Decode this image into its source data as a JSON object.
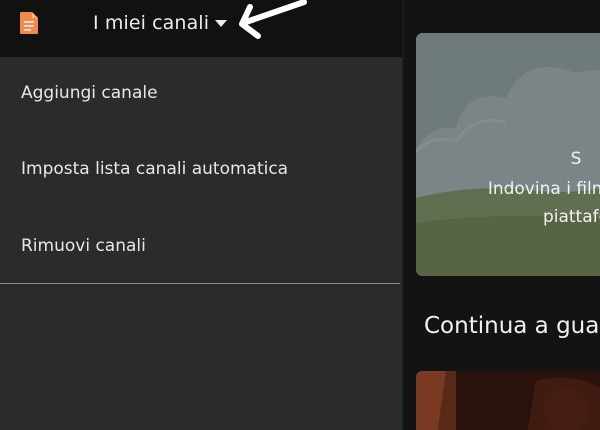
{
  "header": {
    "doc_icon": "document-icon",
    "channels_dropdown_label": "I miei canali",
    "caret_icon": "caret-down-icon",
    "annotation_icon": "arrow-left-icon"
  },
  "menu": {
    "items": [
      {
        "label": "Aggiungi canale"
      },
      {
        "label": "Imposta lista canali automatica"
      },
      {
        "label": "Rimuovi canali"
      }
    ]
  },
  "promo": {
    "line1": "S",
    "line2": "Indovina i film e",
    "line3": "piattafo"
  },
  "continue_section": {
    "title": "Continua a gua"
  },
  "colors": {
    "accent": "#f08a4b",
    "menu_bg": "#2b2b2b",
    "topbar_bg": "#111111",
    "text": "#e8e8e8"
  }
}
